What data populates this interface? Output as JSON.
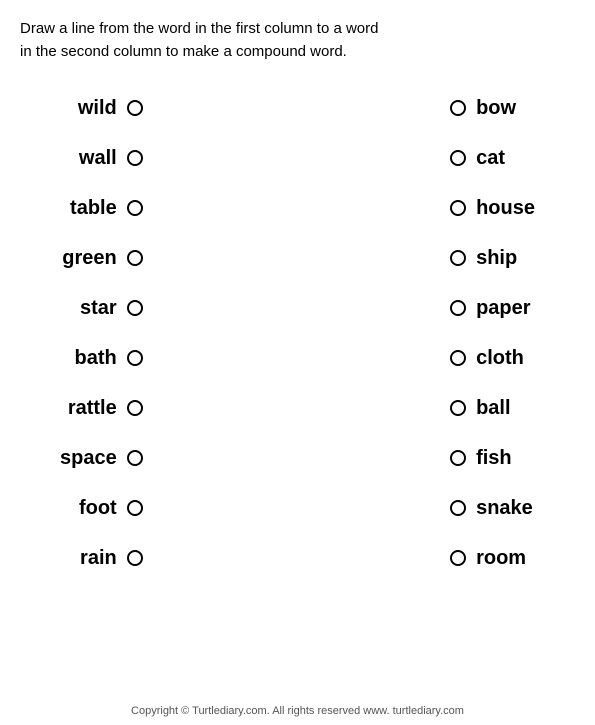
{
  "instruction": {
    "line1": "Draw a line from the word in the first column to a word",
    "line2": "in the second column to make a compound word."
  },
  "left_words": [
    "wild",
    "wall",
    "table",
    "green",
    "star",
    "bath",
    "rattle",
    "space",
    "foot",
    "rain"
  ],
  "right_words": [
    "bow",
    "cat",
    "house",
    "ship",
    "paper",
    "cloth",
    "ball",
    "fish",
    "snake",
    "room"
  ],
  "footer": "Copyright © Turtlediary.com. All rights reserved   www. turtlediary.com"
}
